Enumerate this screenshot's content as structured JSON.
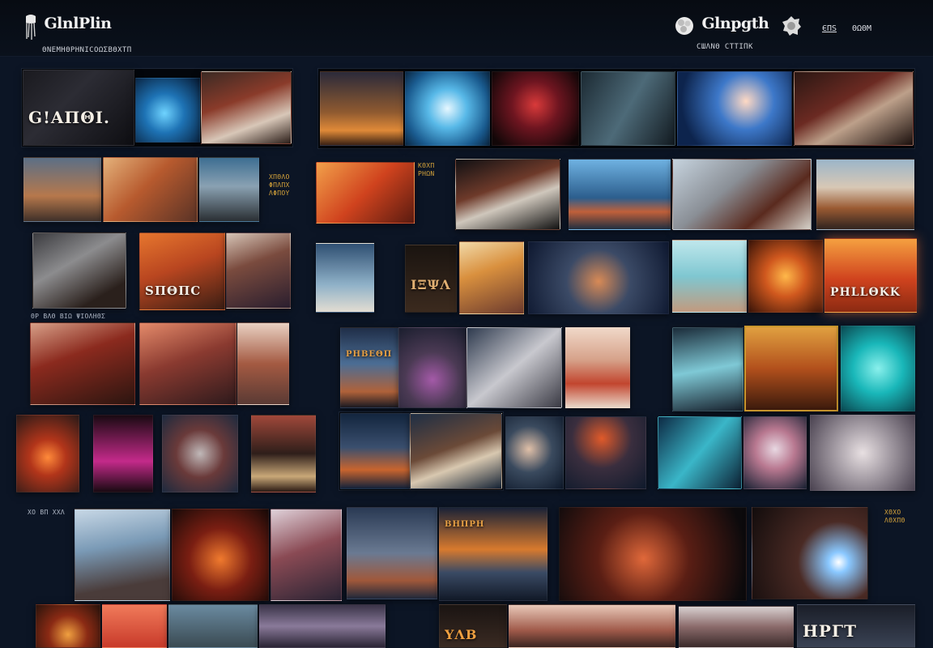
{
  "header": {
    "left_title": "GlnlPlin",
    "left_subtitle": "ΘΝΕΜΗΘΡΗΝΙCΟΩΣΒΘΧΤΠ",
    "right_title": "Glnpgth",
    "right_subtitle": "CШΛΝΘ СТΤΙΠΚ",
    "link_a": "ЄΠS",
    "link_b": "ΘΩΘΜ"
  },
  "labels": {
    "row1_title": "G!ΑΠΘΙ.",
    "row3_title": "SΠΘΠC",
    "row3_right_title": "ΡΗLLΘΚΚ",
    "row3_poster": "ΙΞΨΛ",
    "row4_poster": "ΡΗΒΕΘΠ",
    "row6_poster": "ΒΗΠΡΗ",
    "row7_poster_a": "ΥΛΒ",
    "row7_poster_b": "ΗΡΓΤ",
    "caption_row2": "ΧΠΘΛΟ\nΦΠΛΠΧ\nΛΦΠΟΥ",
    "caption_row2b": "ΚΘΧΠ\nΡΗΩΝ",
    "caption_row4": "ΘΡ ΒΛΘ ΒΙΩ ΨΙΟΛΗΘΣ",
    "caption_row6": "ΧΟ ΒΠ ΧΧΛ",
    "caption_row6b": "ΧΘΧΟ\nΛΘΧΠΘ"
  },
  "colors": {
    "background": "#0c1525",
    "header": "#070b12",
    "accent_orange": "#e2642a",
    "accent_teal": "#19b7b9",
    "accent_gold": "#c9962d"
  },
  "icons": {
    "left_logo": "jellyfish-logo-icon",
    "right_logo": "flower-logo-icon",
    "right_badge": "seal-badge-icon"
  }
}
